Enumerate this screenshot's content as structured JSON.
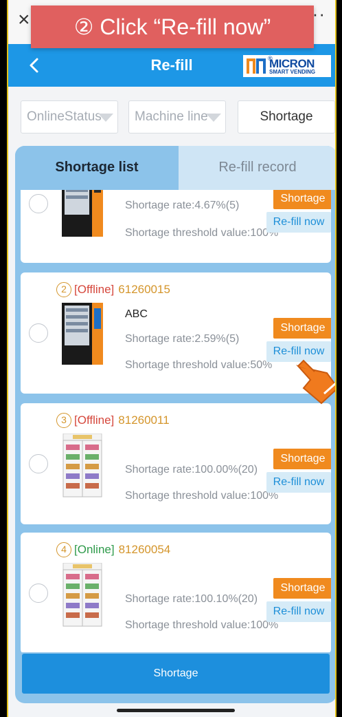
{
  "banner": {
    "text": "② Click “Re-fill now”"
  },
  "header": {
    "title": "Re-fill",
    "logo_name": "MICRON",
    "logo_sub": "SMART VENDING",
    "logo_reg": "®"
  },
  "top": {
    "close": "×",
    "more": "··"
  },
  "filters": [
    {
      "placeholder": "OnlineStatus"
    },
    {
      "placeholder": "Machine line"
    },
    {
      "label": "Shortage"
    }
  ],
  "tabs": {
    "active": "Shortage list",
    "inactive": "Re-fill record"
  },
  "cards": [
    {
      "index": "",
      "status": "",
      "machine_id": "",
      "name": "",
      "rate": "Shortage rate:4.67%(5)",
      "threshold": "Shortage threshold value:100%",
      "shortage_label": "Shortage",
      "refill_label": "Re-fill now"
    },
    {
      "index": "2",
      "status": "[Offline]",
      "machine_id": "61260015",
      "name": "ABC",
      "rate": "Shortage rate:2.59%(5)",
      "threshold": "Shortage threshold value:50%",
      "shortage_label": "Shortage",
      "refill_label": "Re-fill now"
    },
    {
      "index": "3",
      "status": "[Offline]",
      "machine_id": "81260011",
      "name": "",
      "rate": "Shortage rate:100.00%(20)",
      "threshold": "Shortage threshold value:100%",
      "shortage_label": "Shortage",
      "refill_label": "Re-fill now"
    },
    {
      "index": "4",
      "status": "[Online]",
      "machine_id": "81260054",
      "name": "",
      "rate": "Shortage rate:100.10%(20)",
      "threshold": "Shortage threshold value:100%",
      "shortage_label": "Shortage",
      "refill_label": "Re-fill now"
    }
  ],
  "bottom": {
    "button": "Shortage"
  },
  "colors": {
    "header": "#1d97e6",
    "banner": "#e0605f",
    "shortage": "#f08a1e",
    "offline": "#d5463b",
    "online": "#2e9a4a",
    "machine_id": "#d4952b"
  }
}
